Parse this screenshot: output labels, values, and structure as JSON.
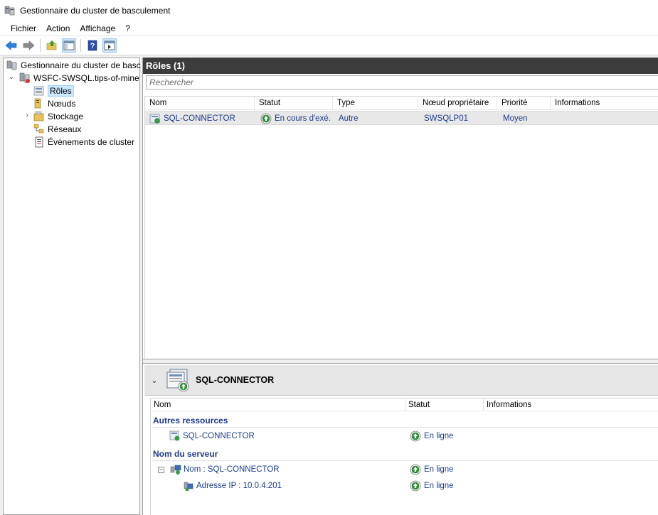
{
  "window": {
    "title": "Gestionnaire du cluster de basculement"
  },
  "menu": {
    "items": [
      "Fichier",
      "Action",
      "Affichage",
      "?"
    ]
  },
  "toolbar": {
    "icons": [
      "back-arrow-icon",
      "forward-arrow-icon",
      "up-folder-icon",
      "show-pane-icon",
      "help-icon",
      "action-pane-icon"
    ]
  },
  "tree": {
    "root": "Gestionnaire du cluster de basc",
    "cluster": "WSFC-SWSQL.tips-of-mine",
    "items": [
      {
        "label": "Rôles",
        "selected": true
      },
      {
        "label": "Nœuds"
      },
      {
        "label": "Stockage"
      },
      {
        "label": "Réseaux"
      },
      {
        "label": "Événements de cluster"
      }
    ]
  },
  "roles": {
    "header": "Rôles (1)",
    "search_placeholder": "Rechercher",
    "columns": [
      "Nom",
      "Statut",
      "Type",
      "Nœud propriétaire",
      "Priorité",
      "Informations"
    ],
    "rows": [
      {
        "name": "SQL-CONNECTOR",
        "status": "En cours d'exé...",
        "type": "Autre",
        "owner": "SWSQLP01",
        "priority": "Moyen",
        "info": ""
      }
    ]
  },
  "detail": {
    "title": "SQL-CONNECTOR",
    "columns": [
      "Nom",
      "Statut",
      "Informations"
    ],
    "groups": [
      {
        "label": "Autres ressources",
        "rows": [
          {
            "name": "SQL-CONNECTOR",
            "status": "En ligne"
          }
        ]
      },
      {
        "label": "Nom du serveur",
        "rows": [
          {
            "name": "Nom : SQL-CONNECTOR",
            "status": "En ligne"
          },
          {
            "name": "Adresse IP : 10.0.4.201",
            "status": "En ligne"
          }
        ]
      }
    ]
  },
  "colors": {
    "link_text": "#1a3c8c",
    "header_bg": "#3c3c3c",
    "group_text": "#1e3a8a",
    "status_green": "#2e8b3a"
  }
}
